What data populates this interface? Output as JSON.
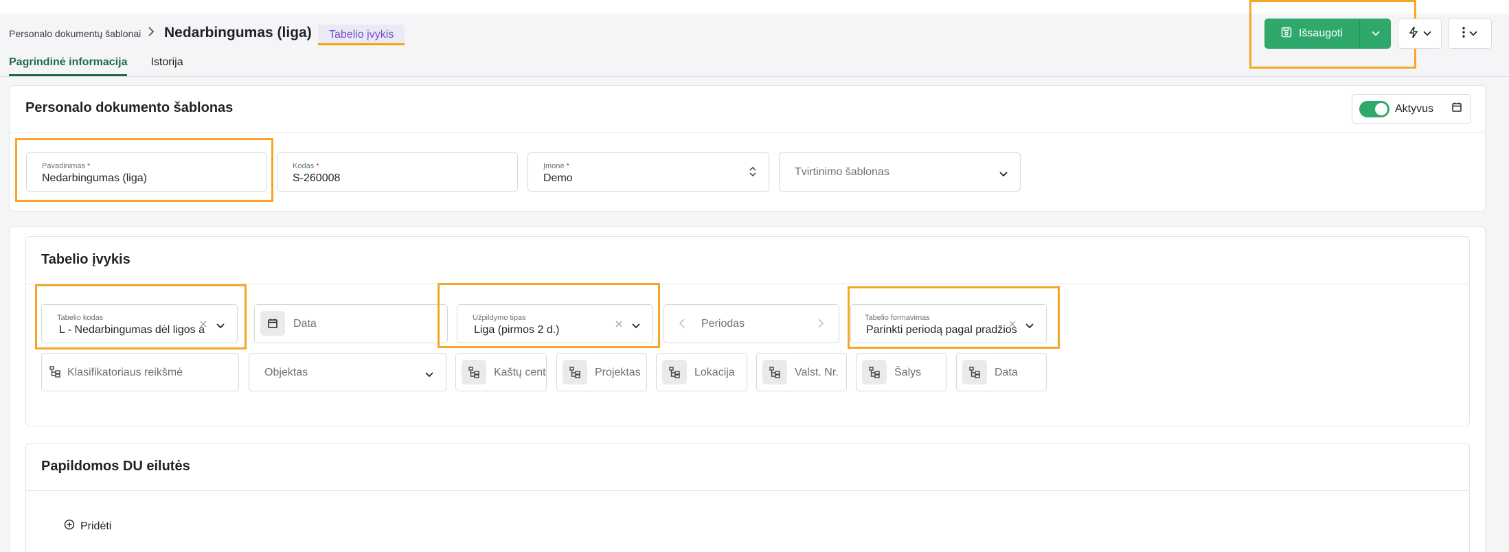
{
  "header": {
    "breadcrumb": "Personalo dokumentų šablonai",
    "title": "Nedarbingumas (liga)",
    "tag": "Tabelio įvykis",
    "tabs": [
      {
        "label": "Pagrindinė informacija",
        "active": true
      },
      {
        "label": "Istorija",
        "active": false
      }
    ],
    "save_label": "Išsaugoti"
  },
  "template_card": {
    "title": "Personalo dokumento šablonas",
    "active_label": "Aktyvus",
    "active": true,
    "fields": {
      "name": {
        "label": "Pavadinimas",
        "value": "Nedarbingumas (liga)"
      },
      "code": {
        "label": "Kodas",
        "value": "S-260008"
      },
      "company": {
        "label": "Įmonė",
        "value": "Demo"
      },
      "approval": {
        "placeholder": "Tvirtinimo šablonas"
      }
    }
  },
  "event_card": {
    "title": "Tabelio įvykis",
    "tabel_code": {
      "label": "Tabelio kodas",
      "value": "L - Nedarbingumas dėl ligos ar"
    },
    "date": {
      "placeholder": "Data"
    },
    "fill_type": {
      "label": "Užpildymo tipas",
      "value": "Liga (pirmos 2 d.)"
    },
    "period": {
      "placeholder": "Periodas"
    },
    "formation": {
      "label": "Tabelio formavimas",
      "value": "Parinkti periodą pagal pradžios"
    },
    "classifier": {
      "placeholder": "Klasifikatoriaus reikšmė"
    },
    "object": {
      "placeholder": "Objektas"
    },
    "dims": [
      {
        "label": "Kaštų cent"
      },
      {
        "label": "Projektas"
      },
      {
        "label": "Lokacija"
      },
      {
        "label": "Valst. Nr."
      },
      {
        "label": "Šalys"
      },
      {
        "label": "Data"
      }
    ]
  },
  "extra_card": {
    "title": "Papildomos DU eilutės",
    "add_label": "Pridėti"
  },
  "colors": {
    "accent_green": "#2ea86b",
    "highlight": "#f5a623",
    "tag_purple": "#6e4fc2"
  }
}
